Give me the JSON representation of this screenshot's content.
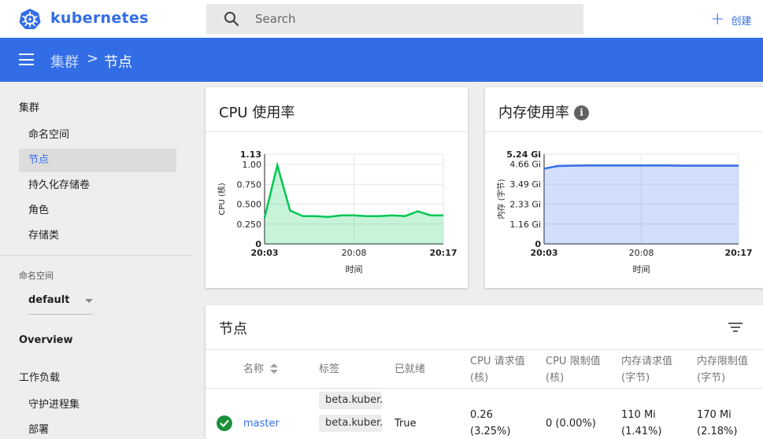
{
  "topbar": {
    "brand": "kubernetes",
    "search_placeholder": "Search",
    "create_label": "创建"
  },
  "breadcrumb": {
    "parent": "集群",
    "separator": ">",
    "current": "节点"
  },
  "sidebar": {
    "cluster_title": "集群",
    "items": [
      {
        "label": "命名空间"
      },
      {
        "label": "节点",
        "active": true
      },
      {
        "label": "持久化存储卷"
      },
      {
        "label": "角色"
      },
      {
        "label": "存储类"
      }
    ],
    "namespace_label": "命名空间",
    "namespace_value": "default",
    "overview": "Overview",
    "workloads": "工作负载",
    "workload_items": [
      {
        "label": "守护进程集"
      },
      {
        "label": "部署"
      }
    ]
  },
  "cpu_card": {
    "title": "CPU 使用率",
    "chart_data": {
      "type": "area",
      "title": "CPU 使用率",
      "xlabel": "时间",
      "ylabel": "CPU (核)",
      "x_ticks": [
        "20:03",
        "20:08",
        "20:17"
      ],
      "y_ticks": [
        "0",
        "0.250",
        "0.500",
        "0.750",
        "1.00",
        "1.13"
      ],
      "ylim": [
        0,
        1.13
      ],
      "series": [
        {
          "color": "#00c752",
          "x": [
            0,
            1,
            2,
            3,
            4,
            5,
            6,
            7,
            8,
            9,
            10,
            11,
            12,
            13,
            14
          ],
          "values": [
            0.33,
            0.99,
            0.42,
            0.35,
            0.35,
            0.34,
            0.36,
            0.36,
            0.35,
            0.35,
            0.36,
            0.35,
            0.41,
            0.36,
            0.36
          ]
        }
      ]
    }
  },
  "mem_card": {
    "title": "内存使用率",
    "chart_data": {
      "type": "area",
      "title": "内存使用率",
      "xlabel": "时间",
      "ylabel": "内存 (字节)",
      "x_ticks": [
        "20:03",
        "20:08",
        "20:17"
      ],
      "y_ticks": [
        "0",
        "1.16 Gi",
        "2.33 Gi",
        "3.49 Gi",
        "4.66 Gi",
        "5.24 Gi"
      ],
      "ylim": [
        0,
        5.24
      ],
      "series": [
        {
          "color": "#326de6",
          "x": [
            0,
            1,
            2,
            3,
            4,
            5,
            6,
            7,
            8,
            9,
            10,
            11,
            12,
            13,
            14
          ],
          "values": [
            4.4,
            4.55,
            4.57,
            4.58,
            4.58,
            4.58,
            4.58,
            4.58,
            4.58,
            4.58,
            4.57,
            4.57,
            4.57,
            4.57,
            4.57
          ]
        }
      ]
    }
  },
  "nodes_card": {
    "title": "节点",
    "columns": {
      "name": "名称",
      "labels": "标签",
      "ready": "已就绪",
      "cpu_req": "CPU 请求值\n(核)",
      "cpu_lim": "CPU 限制值\n(核)",
      "mem_req": "内存请求值\n(字节)",
      "mem_lim": "内存限制值\n(字节)"
    },
    "rows": [
      {
        "name": "master",
        "labels": [
          "beta.kuber.",
          "beta.kuber."
        ],
        "ready": "True",
        "cpu_req": "0.26\n(3.25%)",
        "cpu_lim": "0 (0.00%)",
        "mem_req": "110 Mi\n(1.41%)",
        "mem_lim": "170 Mi\n(2.18%)"
      }
    ]
  },
  "colors": {
    "brand_blue": "#326de6",
    "cpu_green": "#00c752",
    "status_green": "#1a8f3a"
  }
}
